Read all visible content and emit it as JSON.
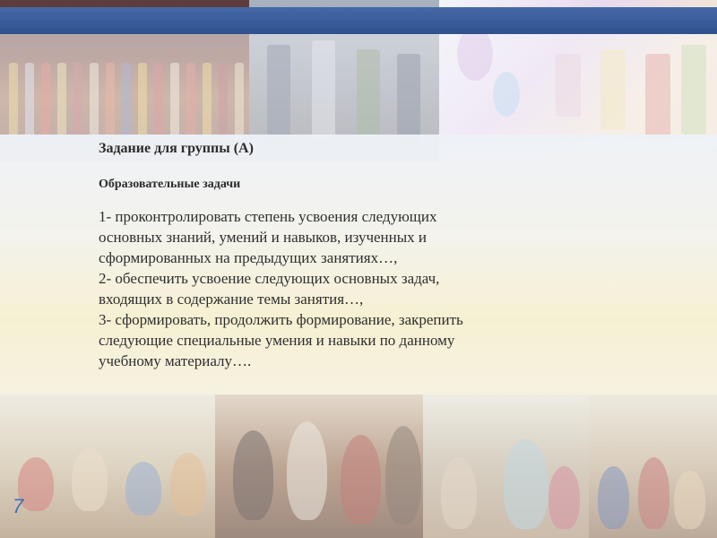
{
  "slide": {
    "heading": "Задание для группы (А)",
    "subheading": "Образовательные задачи",
    "body_lines": [
      "1- проконтролировать степень усвоения следующих",
      "основных знаний, умений и навыков, изученных и",
      "сформированных на предыдущих  занятиях…,",
      "2- обеспечить усвоение следующих основных задач,",
      "входящих в содержание темы занятия…,",
      "3- сформировать, продолжить формирование, закрепить",
      "следующие специальные умения и навыки по данному",
      "учебному материалу…."
    ],
    "slide_number": "7"
  },
  "colors": {
    "top_bar": "#3a5e9c",
    "text": "#2e2e2e",
    "slide_number": "#3f6fb8"
  }
}
